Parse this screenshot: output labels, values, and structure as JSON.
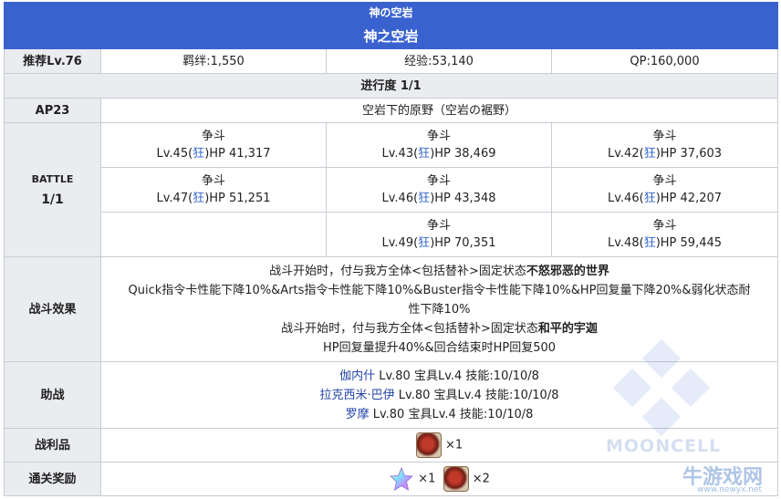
{
  "header": {
    "subtitle": "神の空岩",
    "title": "神之空岩"
  },
  "info": {
    "level": "推荐Lv.76",
    "bond": "羁绊:1,550",
    "exp": "经验:53,140",
    "qp": "QP:160,000"
  },
  "progress": "进行度 1/1",
  "ap": {
    "label": "AP23",
    "location": "空岩下的原野（空岩の裾野）"
  },
  "battle": {
    "label": "BATTLE",
    "count": "1/1",
    "enemies": [
      [
        {
          "name": "争斗",
          "pre": "Lv.45(",
          "cls": "狂",
          "post": ")HP 41,317"
        },
        {
          "name": "争斗",
          "pre": "Lv.43(",
          "cls": "狂",
          "post": ")HP 38,469"
        },
        {
          "name": "争斗",
          "pre": "Lv.42(",
          "cls": "狂",
          "post": ")HP 37,603"
        }
      ],
      [
        {
          "name": "争斗",
          "pre": "Lv.47(",
          "cls": "狂",
          "post": ")HP 51,251"
        },
        {
          "name": "争斗",
          "pre": "Lv.46(",
          "cls": "狂",
          "post": ")HP 43,348"
        },
        {
          "name": "争斗",
          "pre": "Lv.46(",
          "cls": "狂",
          "post": ")HP 42,207"
        }
      ],
      [
        null,
        {
          "name": "争斗",
          "pre": "Lv.49(",
          "cls": "狂",
          "post": ")HP 70,351"
        },
        {
          "name": "争斗",
          "pre": "Lv.48(",
          "cls": "狂",
          "post": ")HP 59,445"
        }
      ]
    ]
  },
  "effects": {
    "label": "战斗效果",
    "line1_pre": "战斗开始时，付与我方全体<包括替补>固定状态",
    "line1_bold": "不怒邪恶的世界",
    "line2": "Quick指令卡性能下降10%&Arts指令卡性能下降10%&Buster指令卡性能下降10%&HP回复量下降20%&弱化状态耐",
    "line3": "性下降10%",
    "line4_pre": "战斗开始时，付与我方全体<包括替补>固定状态",
    "line4_bold": "和平的宇迦",
    "line5": "HP回复量提升40%&回合结束时HP回复500"
  },
  "support": {
    "label": "助战",
    "rows": [
      {
        "name": "伽内什",
        "detail": " Lv.80 宝具Lv.4 技能:10/10/8"
      },
      {
        "name": "拉克西米·巴伊",
        "detail": " Lv.80 宝具Lv.4 技能:10/10/8"
      },
      {
        "name": "罗摩",
        "detail": " Lv.80 宝具Lv.4 技能:10/10/8"
      }
    ]
  },
  "drops": {
    "label": "战利品",
    "count": "×1",
    "icon": "ember-item-icon"
  },
  "clear": {
    "label": "通关奖励",
    "star_count": "×1",
    "item_count": "×2",
    "icons": [
      "saint-quartz-icon",
      "ember-item-icon"
    ]
  },
  "watermark": {
    "text": "MOONCELL",
    "logo": "牛游戏网",
    "url": "www.newyx.net"
  }
}
